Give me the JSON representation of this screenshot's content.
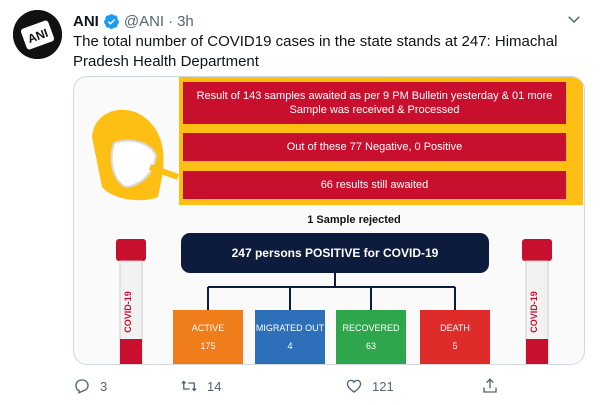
{
  "tweet": {
    "author_name": "ANI",
    "handle": "@ANI",
    "separator": "·",
    "time": "3h",
    "text": "The total number of COVID19 cases in the state stands at 247: Himachal Pradesh Health Department",
    "avatar_text": "ANI"
  },
  "media": {
    "bulletin_line": "Result  of 143 samples awaited as per 9 PM Bulletin yesterday & 01 more Sample was received & Processed",
    "negative_line": "Out of these 77 Negative, 0 Positive",
    "awaited_line": "66 results still  awaited",
    "rejected_line": "1 Sample rejected",
    "positive_line": "247 persons POSITIVE for COVID-19",
    "tube_label": "COVID-19",
    "categories": [
      {
        "label": "ACTIVE",
        "value": "175"
      },
      {
        "label": "MIGRATED OUT",
        "value": "4"
      },
      {
        "label": "RECOVERED",
        "value": "63"
      },
      {
        "label": "DEATH",
        "value": "5"
      }
    ],
    "colors": {
      "banner_yellow": "#fdbf14",
      "banner_red": "#c8102e",
      "positive_navy": "#0d1b3d",
      "active": "#ef7d1a",
      "migrated": "#2e6fb9",
      "recovered": "#2ea64b",
      "death": "#e02b2b"
    }
  },
  "actions": {
    "reply_count": "3",
    "retweet_count": "14",
    "like_count": "121"
  },
  "icons": {
    "verified": "verified-badge-icon",
    "more": "chevron-down-icon",
    "reply": "reply-icon",
    "retweet": "retweet-icon",
    "like": "heart-icon",
    "share": "share-icon"
  }
}
